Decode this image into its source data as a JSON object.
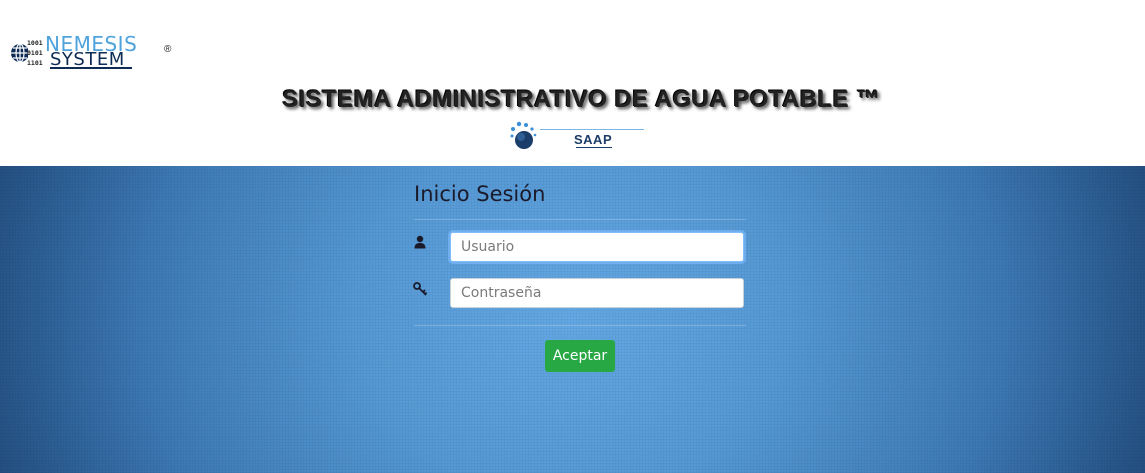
{
  "brand": {
    "bits": [
      "1001",
      "0101",
      "1101"
    ],
    "name_top": "NEMESIS",
    "name_bottom": "SYSTEM",
    "registered": "®"
  },
  "header": {
    "title": "SISTEMA ADMINISTRATIVO DE AGUA POTABLE ™",
    "app_logo_text": "SAAP"
  },
  "login": {
    "heading": "Inicio Sesión",
    "username_placeholder": "Usuario",
    "username_value": "",
    "password_placeholder": "Contraseña",
    "password_value": "",
    "submit_label": "Aceptar"
  },
  "colors": {
    "accent_button": "#28a745",
    "background_center": "#63a8e4",
    "background_edge": "#204a7c",
    "brand_light": "#4ea3dc",
    "brand_dark": "#0d2b55"
  },
  "icons": {
    "username": "user-icon",
    "password": "key-icon"
  }
}
